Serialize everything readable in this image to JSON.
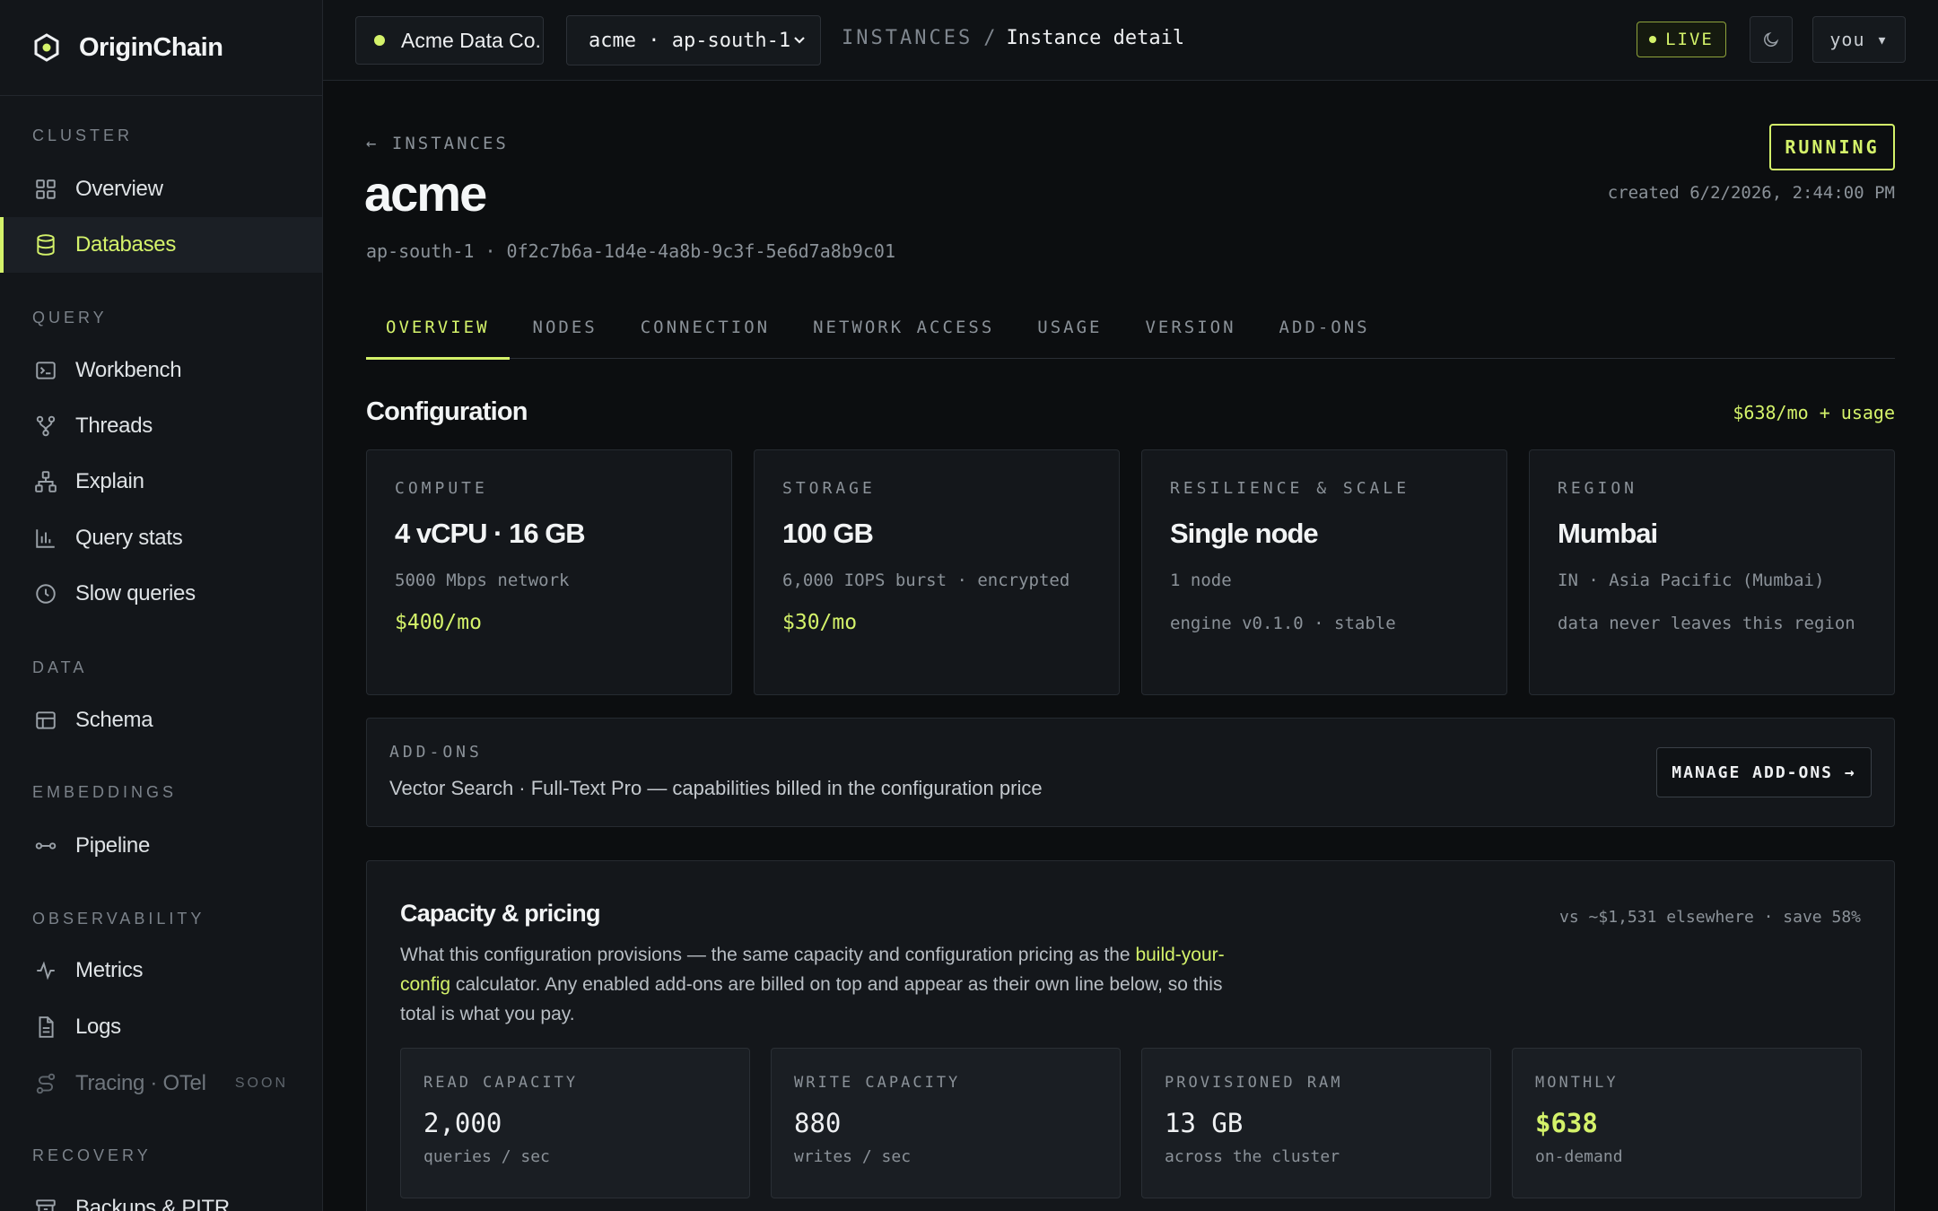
{
  "brand": {
    "name": "OriginChain"
  },
  "sidebar": {
    "sections": [
      {
        "title": "CLUSTER"
      },
      {
        "title": "QUERY"
      },
      {
        "title": "DATA"
      },
      {
        "title": "EMBEDDINGS"
      },
      {
        "title": "OBSERVABILITY"
      },
      {
        "title": "RECOVERY"
      }
    ],
    "items": [
      {
        "label": "Overview",
        "icon": "grid-icon"
      },
      {
        "label": "Databases",
        "icon": "database-icon",
        "active": true
      },
      {
        "label": "Workbench",
        "icon": "terminal-icon"
      },
      {
        "label": "Threads",
        "icon": "branch-icon"
      },
      {
        "label": "Explain",
        "icon": "hierarchy-icon"
      },
      {
        "label": "Query stats",
        "icon": "bar-chart-icon"
      },
      {
        "label": "Slow queries",
        "icon": "clock-icon"
      },
      {
        "label": "Schema",
        "icon": "table-icon"
      },
      {
        "label": "Pipeline",
        "icon": "pipeline-icon"
      },
      {
        "label": "Metrics",
        "icon": "pulse-icon"
      },
      {
        "label": "Logs",
        "icon": "file-icon"
      },
      {
        "label": "Tracing · OTel",
        "icon": "trace-icon",
        "badge": "SOON",
        "disabled": true
      },
      {
        "label": "Backups & PITR",
        "icon": "archive-icon"
      }
    ]
  },
  "topbar": {
    "org": "Acme Data Co.",
    "cluster_select": "acme · ap-south-1",
    "breadcrumb_root": "INSTANCES",
    "breadcrumb_sep": "/",
    "breadcrumb_current": "Instance detail",
    "live": "LIVE",
    "user": "you ▾"
  },
  "header": {
    "back": "← INSTANCES",
    "title": "acme",
    "meta": "ap-south-1 · 0f2c7b6a-1d4e-4a8b-9c3f-5e6d7a8b9c01",
    "status": "RUNNING",
    "created": "created 6/2/2026, 2:44:00 PM"
  },
  "tabs": [
    "OVERVIEW",
    "NODES",
    "CONNECTION",
    "NETWORK ACCESS",
    "USAGE",
    "VERSION",
    "ADD-ONS"
  ],
  "configuration": {
    "title": "Configuration",
    "total": "$638/mo + usage",
    "cards": [
      {
        "label": "COMPUTE",
        "value": "4 vCPU · 16 GB",
        "sub": "5000 Mbps network",
        "price": "$400/mo"
      },
      {
        "label": "STORAGE",
        "value": "100 GB",
        "sub": "6,000 IOPS burst · encrypted",
        "price": "$30/mo"
      },
      {
        "label": "RESILIENCE & SCALE",
        "value": "Single node",
        "sub": "1 node",
        "sub2": "engine v0.1.0 · stable"
      },
      {
        "label": "REGION",
        "value": "Mumbai",
        "sub": "IN · Asia Pacific (Mumbai)",
        "sub2": "data never leaves this region"
      }
    ]
  },
  "addons": {
    "label": "ADD-ONS",
    "text": "Vector Search · Full-Text Pro — capabilities billed in the configuration price",
    "button": "MANAGE ADD-ONS →"
  },
  "capacity": {
    "title": "Capacity & pricing",
    "compare": "vs ~$1,531 elsewhere · save 58%",
    "desc_before": "What this configuration provisions — the same capacity and configuration pricing as the ",
    "desc_link": "build-your-config",
    "desc_after": " calculator. Any enabled add-ons are billed on top and appear as their own line below, so this total is what you pay.",
    "stats": [
      {
        "label": "READ CAPACITY",
        "value": "2,000",
        "sub": "queries / sec"
      },
      {
        "label": "WRITE CAPACITY",
        "value": "880",
        "sub": "writes / sec"
      },
      {
        "label": "PROVISIONED RAM",
        "value": "13 GB",
        "sub": "across the cluster"
      },
      {
        "label": "MONTHLY",
        "value": "$638",
        "sub": "on-demand",
        "accent": true
      }
    ]
  },
  "colors": {
    "accent": "#d4f26a",
    "background": "#0c0e10",
    "panel": "#14171b"
  }
}
